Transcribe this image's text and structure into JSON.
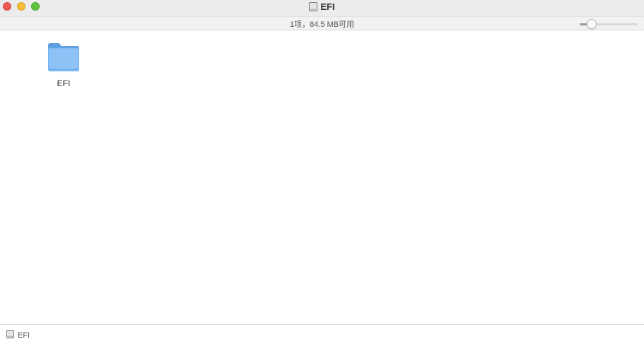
{
  "window": {
    "title": "EFI",
    "title_icon": "drive-icon"
  },
  "statusbar": {
    "text": "1项，84.5 MB可用",
    "icon_size_level": 0.15
  },
  "content": {
    "items": [
      {
        "name": "EFI",
        "icon": "folder-icon"
      }
    ]
  },
  "pathbar": {
    "items": [
      {
        "label": "EFI",
        "icon": "drive-icon"
      }
    ]
  },
  "colors": {
    "close": "#ee5d55",
    "minimize": "#f6bd3b",
    "zoom": "#5fc43f",
    "folder": "#6aaef0"
  }
}
